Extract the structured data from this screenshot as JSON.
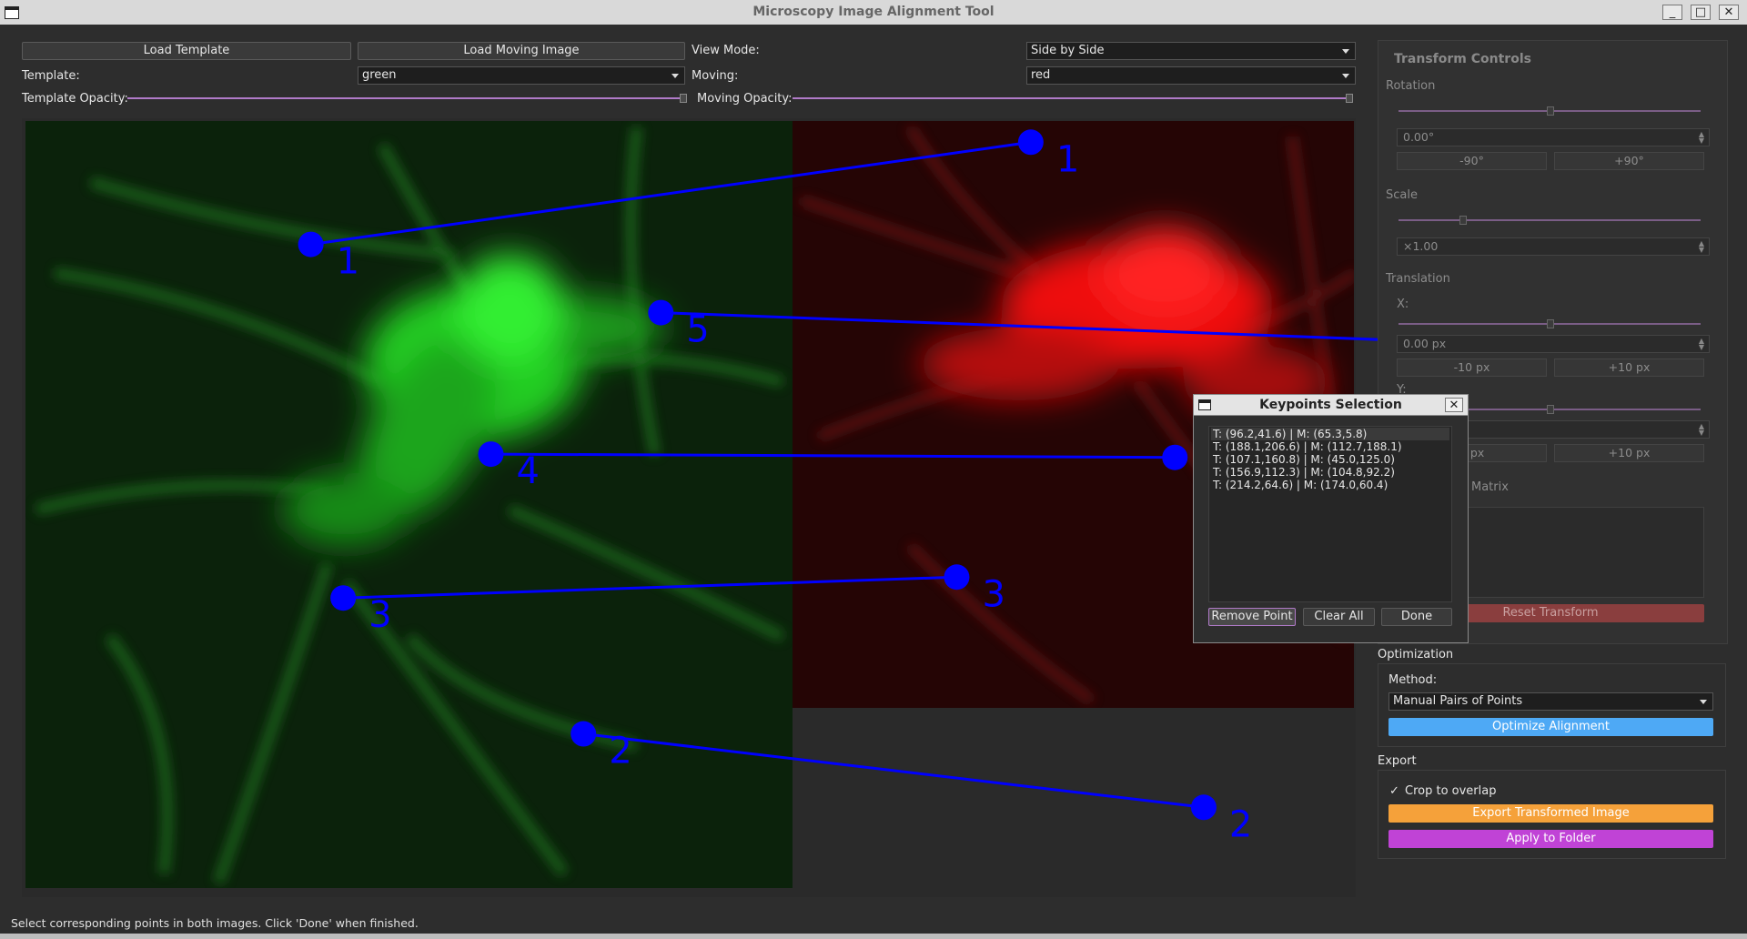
{
  "window": {
    "title": "Microscopy Image Alignment Tool",
    "minimize_glyph": "_",
    "maximize_glyph": "□",
    "close_glyph": "✕"
  },
  "toolbar": {
    "load_template": "Load Template",
    "load_moving": "Load Moving Image",
    "view_mode_label": "View Mode:",
    "view_mode_value": "Side by Side",
    "template_label": "Template:",
    "template_value": "green",
    "moving_label": "Moving:",
    "moving_value": "red",
    "template_opacity_label": "Template Opacity:",
    "template_opacity": 1.0,
    "moving_opacity_label": "Moving Opacity:",
    "moving_opacity": 1.0
  },
  "keypoints": {
    "template": [
      {
        "label": "1",
        "x": 96.2,
        "y": 41.6
      },
      {
        "label": "2",
        "x": 188.1,
        "y": 206.6
      },
      {
        "label": "3",
        "x": 107.1,
        "y": 160.8
      },
      {
        "label": "4",
        "x": 156.9,
        "y": 112.3
      },
      {
        "label": "5",
        "x": 214.2,
        "y": 64.6
      }
    ],
    "moving": [
      {
        "label": "1",
        "x": 65.3,
        "y": 5.8
      },
      {
        "label": "2",
        "x": 112.7,
        "y": 188.1
      },
      {
        "label": "3",
        "x": 45.0,
        "y": 125.0
      },
      {
        "label": "4",
        "x": 104.8,
        "y": 92.2
      },
      {
        "label": "5",
        "x": 174.0,
        "y": 60.4
      }
    ],
    "color": "#0000ff"
  },
  "transform_controls": {
    "title": "Transform Controls",
    "rotation_label": "Rotation",
    "rotation_value": "0.00°",
    "rot_minus": "-90°",
    "rot_plus": "+90°",
    "scale_label": "Scale",
    "scale_value": "×1.00",
    "translation_label": "Translation",
    "x_label": "X:",
    "x_value": "0.00 px",
    "x_minus": "-10 px",
    "x_plus": "+10 px",
    "y_label": "Y:",
    "y_minus": "0 px",
    "y_plus": "+10 px",
    "matrix_label": "Matrix",
    "reset": "Reset Transform"
  },
  "optimization": {
    "title": "Optimization",
    "method_label": "Method:",
    "method_value": "Manual Pairs of Points",
    "optimize": "Optimize Alignment"
  },
  "export": {
    "title": "Export",
    "crop_label": "Crop to overlap",
    "crop_checked": true,
    "export_btn": "Export Transformed Image",
    "apply_btn": "Apply to Folder"
  },
  "dialog": {
    "title": "Keypoints Selection",
    "close_glyph": "✕",
    "items": [
      "T: (96.2,41.6) | M: (65.3,5.8)",
      "T: (188.1,206.6) | M: (112.7,188.1)",
      "T: (107.1,160.8) | M: (45.0,125.0)",
      "T: (156.9,112.3) | M: (104.8,92.2)",
      "T: (214.2,64.6) | M: (174.0,60.4)"
    ],
    "selected_index": 0,
    "remove": "Remove Point",
    "clear": "Clear All",
    "done": "Done"
  },
  "status": "Select corresponding points in both images. Click 'Done' when finished."
}
